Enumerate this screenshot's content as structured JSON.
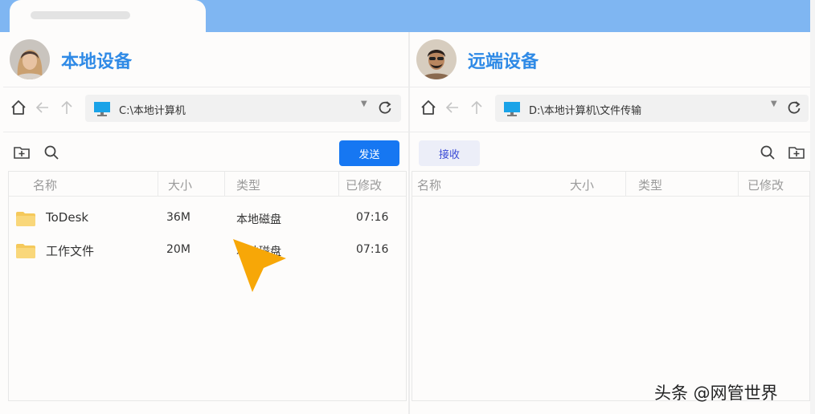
{
  "local": {
    "title": "本地设备",
    "path": "C:\\本地计算机",
    "send_label": "发送",
    "columns": [
      "名称",
      "大小",
      "类型",
      "已修改"
    ],
    "files": [
      {
        "name": "ToDesk",
        "size": "36M",
        "type": "本地磁盘",
        "modified": "07:16"
      },
      {
        "name": "工作文件",
        "size": "20M",
        "type": "本地磁盘",
        "modified": "07:16"
      }
    ]
  },
  "remote": {
    "title": "远端设备",
    "path": "D:\\本地计算机\\文件传输",
    "receive_label": "接收",
    "columns": [
      "名称",
      "大小",
      "类型",
      "已修改"
    ]
  },
  "watermark": "头条 @网管世界",
  "colors": {
    "accent_blue": "#1677f2",
    "title_blue": "#2f8ae6",
    "topbar": "#7fb6f2",
    "folder": "#f5c95b",
    "cursor": "#f7a707"
  },
  "icons": [
    "home-icon",
    "back-arrow-icon",
    "up-arrow-icon",
    "monitor-icon",
    "dropdown-caret-icon",
    "refresh-icon",
    "new-folder-icon",
    "search-icon",
    "folder-icon",
    "pointer-cursor-icon"
  ]
}
